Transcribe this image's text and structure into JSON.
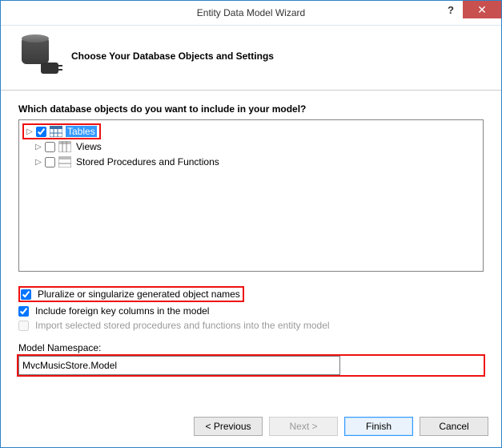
{
  "window": {
    "title": "Entity Data Model Wizard"
  },
  "header": {
    "title": "Choose Your Database Objects and Settings"
  },
  "body": {
    "question": "Which database objects do you want to include in your model?",
    "tree": {
      "tables": "Tables",
      "views": "Views",
      "sprocs": "Stored Procedures and Functions"
    },
    "options": {
      "pluralize": "Pluralize or singularize generated object names",
      "fk": "Include foreign key columns in the model",
      "import_sprocs": "Import selected stored procedures and functions into the entity model"
    },
    "namespace": {
      "label": "Model Namespace:",
      "value": "MvcMusicStore.Model"
    }
  },
  "footer": {
    "previous": "< Previous",
    "next": "Next >",
    "finish": "Finish",
    "cancel": "Cancel"
  }
}
